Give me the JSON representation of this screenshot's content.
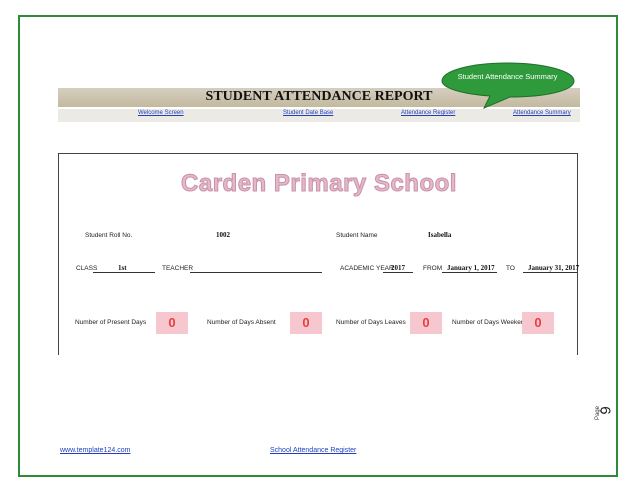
{
  "report": {
    "title": "STUDENT ATTENDANCE REPORT"
  },
  "callout": {
    "text": "Student Attendance Summary"
  },
  "nav": [
    {
      "label": "Welcome Screen"
    },
    {
      "label": "Student Date Base"
    },
    {
      "label": "Attendance Register"
    },
    {
      "label": "Attendance Summary"
    }
  ],
  "school": {
    "name": "Carden Primary School"
  },
  "student": {
    "roll_label": "Student Roll No.",
    "roll_value": "1002",
    "name_label": "Student Name",
    "name_value": "Isabella",
    "class_label": "CLASS",
    "class_value": "1st",
    "teacher_label": "TEACHER",
    "teacher_value": "",
    "year_label": "ACADEMIC YEAR",
    "year_value": "2017",
    "from_label": "FROM",
    "from_value": "January 1, 2017",
    "to_label": "TO",
    "to_value": "January 31, 2017"
  },
  "counts": [
    {
      "label": "Number of Present Days",
      "value": "0"
    },
    {
      "label": "Number of Days Absent",
      "value": "0"
    },
    {
      "label": "Number of Days Leaves",
      "value": "0"
    },
    {
      "label": "Number of Days Weekend",
      "value": "0"
    }
  ],
  "footer": {
    "website": "www.template124.com",
    "doc_title": "School Attendance Register"
  },
  "page": {
    "label": "Page",
    "number": "9"
  },
  "colors": {
    "border": "#2e8b3a",
    "callout": "#2e9a3c",
    "school_name": "#e5b7c9",
    "count_box": "#f6c7cf",
    "count_text": "#e8403c",
    "link": "#1f3fbf"
  }
}
